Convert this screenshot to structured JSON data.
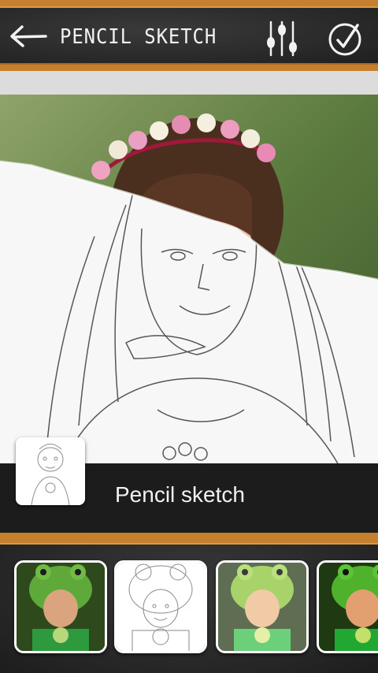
{
  "header": {
    "title": "PENCIL SKETCH",
    "back_icon": "back-arrow-icon",
    "adjust_icon": "sliders-icon",
    "done_icon": "check-circle-icon"
  },
  "effect": {
    "label": "Pencil sketch",
    "thumb_icon": "pencil-sketch-thumbnail"
  },
  "filters": [
    {
      "name": "original",
      "selected": false
    },
    {
      "name": "pencil-sketch",
      "selected": true
    },
    {
      "name": "soft-glow",
      "selected": false
    },
    {
      "name": "color",
      "selected": false
    }
  ],
  "colors": {
    "frame": "#c57f2d",
    "chalkboard": "#2a2a2a",
    "band": "#1c1c1c"
  }
}
